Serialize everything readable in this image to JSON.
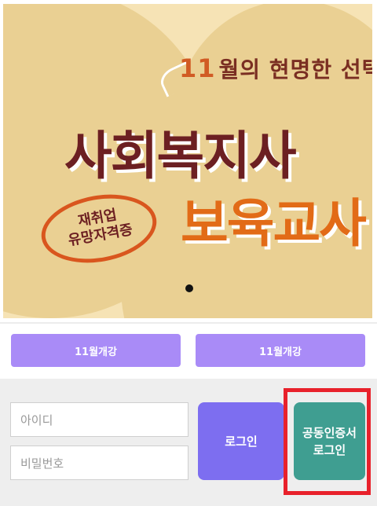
{
  "banner": {
    "subtitle_num": "11",
    "subtitle_text": "월의 현명한 선택",
    "title_line1": "사회복지사",
    "title_line2": "보육교사",
    "stamp_line1": "재취업",
    "stamp_line2": "유망자격증",
    "carousel_dots": 1
  },
  "buttons": {
    "left_label": "11월개강",
    "right_label": "11월개강"
  },
  "login": {
    "id_placeholder": "아이디",
    "pw_placeholder": "비밀번호",
    "login_label": "로그인",
    "cert_line1": "공동인증서",
    "cert_line2": "로그인"
  },
  "colors": {
    "accent_purple": "#a98bf7",
    "login_purple": "#7d6ef0",
    "cert_teal": "#3f9e91",
    "highlight_red": "#e8212b"
  }
}
